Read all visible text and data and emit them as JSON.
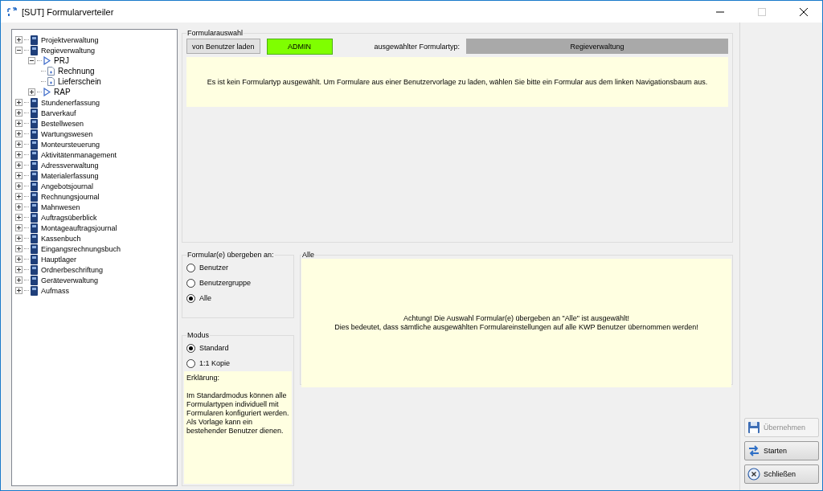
{
  "window": {
    "title": "[SUT] Formularverteiler",
    "maximize_disabled": true
  },
  "tree": [
    {
      "label": "Projektverwaltung",
      "kind": "module",
      "expanded": false
    },
    {
      "label": "Regieverwaltung",
      "kind": "module",
      "expanded": true,
      "children": [
        {
          "label": "PRJ",
          "kind": "type",
          "expanded": true,
          "children": [
            {
              "label": "Rechnung",
              "kind": "form"
            },
            {
              "label": "Lieferschein",
              "kind": "form"
            }
          ]
        },
        {
          "label": "RAP",
          "kind": "type",
          "expanded": false
        }
      ]
    },
    {
      "label": "Stundenerfassung",
      "kind": "module",
      "expanded": false
    },
    {
      "label": "Barverkauf",
      "kind": "module",
      "expanded": false
    },
    {
      "label": "Bestellwesen",
      "kind": "module",
      "expanded": false
    },
    {
      "label": "Wartungswesen",
      "kind": "module",
      "expanded": false
    },
    {
      "label": "Monteursteuerung",
      "kind": "module",
      "expanded": false
    },
    {
      "label": "Aktivitätenmanagement",
      "kind": "module",
      "expanded": false
    },
    {
      "label": "Adressverwaltung",
      "kind": "module",
      "expanded": false
    },
    {
      "label": "Materialerfassung",
      "kind": "module",
      "expanded": false
    },
    {
      "label": "Angebotsjournal",
      "kind": "module",
      "expanded": false
    },
    {
      "label": "Rechnungsjournal",
      "kind": "module",
      "expanded": false
    },
    {
      "label": "Mahnwesen",
      "kind": "module",
      "expanded": false
    },
    {
      "label": "Auftragsüberblick",
      "kind": "module",
      "expanded": false
    },
    {
      "label": "Montageauftragsjournal",
      "kind": "module",
      "expanded": false
    },
    {
      "label": "Kassenbuch",
      "kind": "module",
      "expanded": false
    },
    {
      "label": "Eingangsrechnungsbuch",
      "kind": "module",
      "expanded": false
    },
    {
      "label": "Hauptlager",
      "kind": "module",
      "expanded": false
    },
    {
      "label": "Ordnerbeschriftung",
      "kind": "module",
      "expanded": false
    },
    {
      "label": "Geräteverwaltung",
      "kind": "module",
      "expanded": false
    },
    {
      "label": "Aufmass",
      "kind": "module",
      "expanded": false
    }
  ],
  "form_selection": {
    "title": "Formularauswahl",
    "load_button": "von Benutzer laden",
    "user": "ADMIN",
    "type_label": "ausgewählter Formulartyp:",
    "type_value": "Regieverwaltung",
    "notice": "Es ist kein Formulartyp ausgewählt. Um Formulare aus einer Benutzervorlage zu laden, wählen Sie bitte ein Formular aus dem linken Navigationsbaum aus."
  },
  "transfer_to": {
    "title": "Formular(e) übergeben an:",
    "options": [
      {
        "label": "Benutzer",
        "selected": false
      },
      {
        "label": "Benutzergruppe",
        "selected": false
      },
      {
        "label": "Alle",
        "selected": true
      }
    ]
  },
  "mode": {
    "title": "Modus",
    "options": [
      {
        "label": "Standard",
        "selected": true
      },
      {
        "label": "1:1 Kopie",
        "selected": false
      }
    ],
    "explanation_title": "Erklärung:",
    "explanation": "Im Standardmodus können alle Formulartypen individuell mit Formularen konfiguriert werden. Als Vorlage kann ein bestehender Benutzer dienen."
  },
  "target": {
    "title": "Alle",
    "lines": [
      "Achtung! Die Auswahl Formular(e) übergeben an \"Alle\" ist ausgewählt!",
      "Dies bedeutet, dass sämtliche ausgewählten Formulareinstellungen auf alle KWP Benutzer übernommen werden!"
    ]
  },
  "actions": [
    {
      "label": "Übernehmen",
      "kind": "save",
      "disabled": true
    },
    {
      "label": "Starten",
      "kind": "start",
      "disabled": false
    },
    {
      "label": "Schließen",
      "kind": "close",
      "disabled": false
    }
  ]
}
